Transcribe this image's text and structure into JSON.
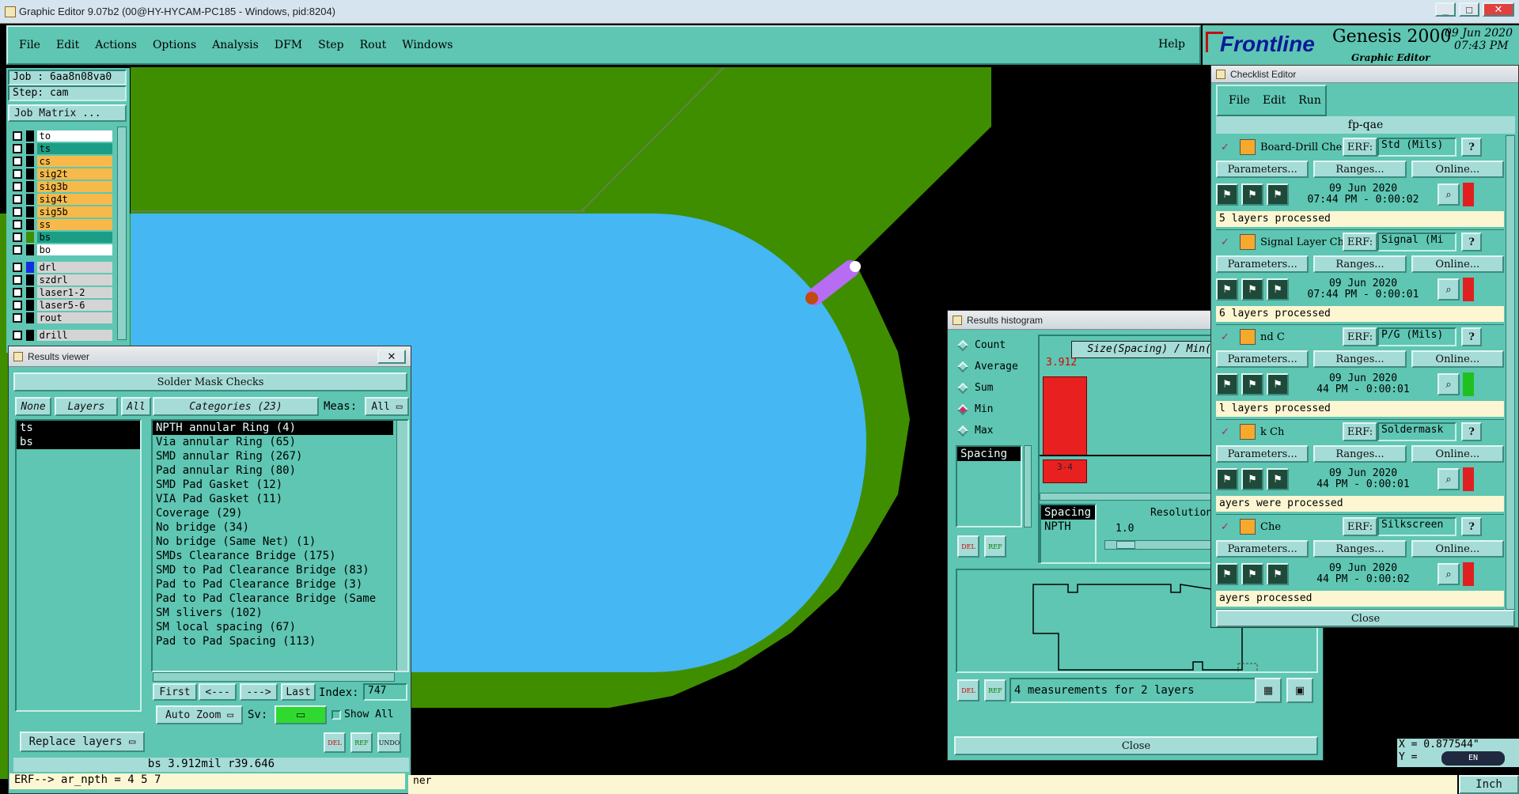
{
  "titlebar": {
    "title": "Graphic Editor 9.07b2 (00@HY-HYCAM-PC185 - Windows, pid:8204)"
  },
  "menubar": {
    "items": [
      "File",
      "Edit",
      "Actions",
      "Options",
      "Analysis",
      "DFM",
      "Step",
      "Rout",
      "Windows"
    ],
    "help": "Help"
  },
  "brand": {
    "logo": "Frontline",
    "product": "Genesis 2000",
    "subtitle": "Graphic Editor",
    "date": "09 Jun 2020",
    "time": "07:43 PM"
  },
  "job": {
    "job": "Job : 6aa8n08va0",
    "step": "Step: cam",
    "matrix_button": "Job Matrix ..."
  },
  "layers": [
    {
      "name": "to",
      "color": "#ffffff"
    },
    {
      "name": "ts",
      "color": "#1b9e85"
    },
    {
      "name": "cs",
      "color": "#f6b94a"
    },
    {
      "name": "sig2t",
      "color": "#f6b94a"
    },
    {
      "name": "sig3b",
      "color": "#f6b94a"
    },
    {
      "name": "sig4t",
      "color": "#f6b94a"
    },
    {
      "name": "sig5b",
      "color": "#f6b94a"
    },
    {
      "name": "ss",
      "color": "#f6b94a"
    },
    {
      "name": "bs",
      "color": "#1b9e85"
    },
    {
      "name": "bo",
      "color": "#ffffff"
    }
  ],
  "drill_layers": [
    {
      "name": "drl"
    },
    {
      "name": "szdrl"
    },
    {
      "name": "laser1-2"
    },
    {
      "name": "laser5-6"
    },
    {
      "name": "rout"
    }
  ],
  "drill_extra": [
    {
      "name": "drill"
    }
  ],
  "results_viewer": {
    "title": "Results viewer",
    "header": "Solder Mask Checks",
    "none_btn": "None",
    "layers_btn": "Layers",
    "all_btn": "All",
    "layer_list": [
      "ts",
      "bs"
    ],
    "categories_btn": "Categories (23)",
    "meas_label": "Meas:",
    "meas_value": "All",
    "categories": [
      "NPTH annular Ring (4)",
      "Via annular Ring (65)",
      "SMD annular Ring (267)",
      "Pad annular Ring (80)",
      "SMD Pad Gasket (12)",
      "VIA Pad Gasket (11)",
      "Coverage (29)",
      "No bridge (34)",
      "No bridge (Same Net) (1)",
      "SMDs Clearance Bridge (175)",
      "SMD to Pad Clearance Bridge (83)",
      "Pad to Pad Clearance Bridge (3)",
      "Pad to Pad Clearance Bridge (Same",
      "SM slivers (102)",
      "SM local spacing (67)",
      "Pad to Pad Spacing (113)"
    ],
    "first": "First",
    "prev": "<---",
    "next": "--->",
    "last": "Last",
    "index_label": "Index:",
    "index_value": "747",
    "zoom": "Auto Zoom",
    "sv_label": "Sv:",
    "show_all": "Show All",
    "replace": "Replace layers",
    "del": "DEL",
    "ref": "REF",
    "undo": "UNDO",
    "status": "bs 3.912mil  r39.646"
  },
  "erf_line": "ERF--> ar_npth = 4 5 7",
  "bottom_text": "ner",
  "histogram": {
    "title": "Results histogram",
    "modes": [
      {
        "label": "Count",
        "on": false
      },
      {
        "label": "Average",
        "on": false
      },
      {
        "label": "Sum",
        "on": false
      },
      {
        "label": "Min",
        "on": true
      },
      {
        "label": "Max",
        "on": false
      }
    ],
    "list_item": "Spacing",
    "chart_title": "Size(Spacing) / Min(Spacing)",
    "bar_value": "3.912",
    "bar_label": "3-4",
    "sel1": "Spacing",
    "sel2": "NPTH",
    "res_label": "Resolution",
    "res_value": "1.0",
    "del": "DEL",
    "ref": "REF",
    "measurements": "4 measurements for 2 layers",
    "close": "Close"
  },
  "checklist": {
    "title": "Checklist Editor",
    "menu": [
      "File",
      "Edit",
      "Run"
    ],
    "name": "fp-qae",
    "checks": [
      {
        "name": "Board-Drill Che",
        "erf": "ERF:",
        "mode": "Std (Mils)",
        "date": "09 Jun 2020",
        "time": "07:44 PM - 0:00:02",
        "msg": "5 layers processed",
        "status": "#e02020"
      },
      {
        "name": "Signal Layer Ch",
        "erf": "ERF:",
        "mode": "Signal (Mi",
        "date": "09 Jun 2020",
        "time": "07:44 PM - 0:00:01",
        "msg": "6 layers processed",
        "status": "#e02020"
      },
      {
        "name": "nd C",
        "erf": "ERF:",
        "mode": "P/G (Mils)",
        "date": "09 Jun 2020",
        "time": "44 PM - 0:00:01",
        "msg": "l layers processed",
        "status": "#20c020"
      },
      {
        "name": "k Ch",
        "erf": "ERF:",
        "mode": "Soldermask",
        "date": "09 Jun 2020",
        "time": "44 PM - 0:00:01",
        "msg": "ayers were processed",
        "status": "#e02020"
      },
      {
        "name": "Che",
        "erf": "ERF:",
        "mode": "Silkscreen",
        "date": "09 Jun 2020",
        "time": "44 PM - 0:00:02",
        "msg": "ayers processed",
        "status": "#e02020"
      }
    ],
    "params": "Parameters...",
    "ranges": "Ranges...",
    "online": "Online...",
    "close": "Close"
  },
  "coords": {
    "x": "X = 0.877544\"",
    "y": "Y =",
    "unit": "Inch",
    "lang": "EN"
  },
  "colors": {
    "green": "#3f8e00",
    "blue": "#45b7f3",
    "teal": "#5ec6b2",
    "purple": "#b66df4"
  }
}
